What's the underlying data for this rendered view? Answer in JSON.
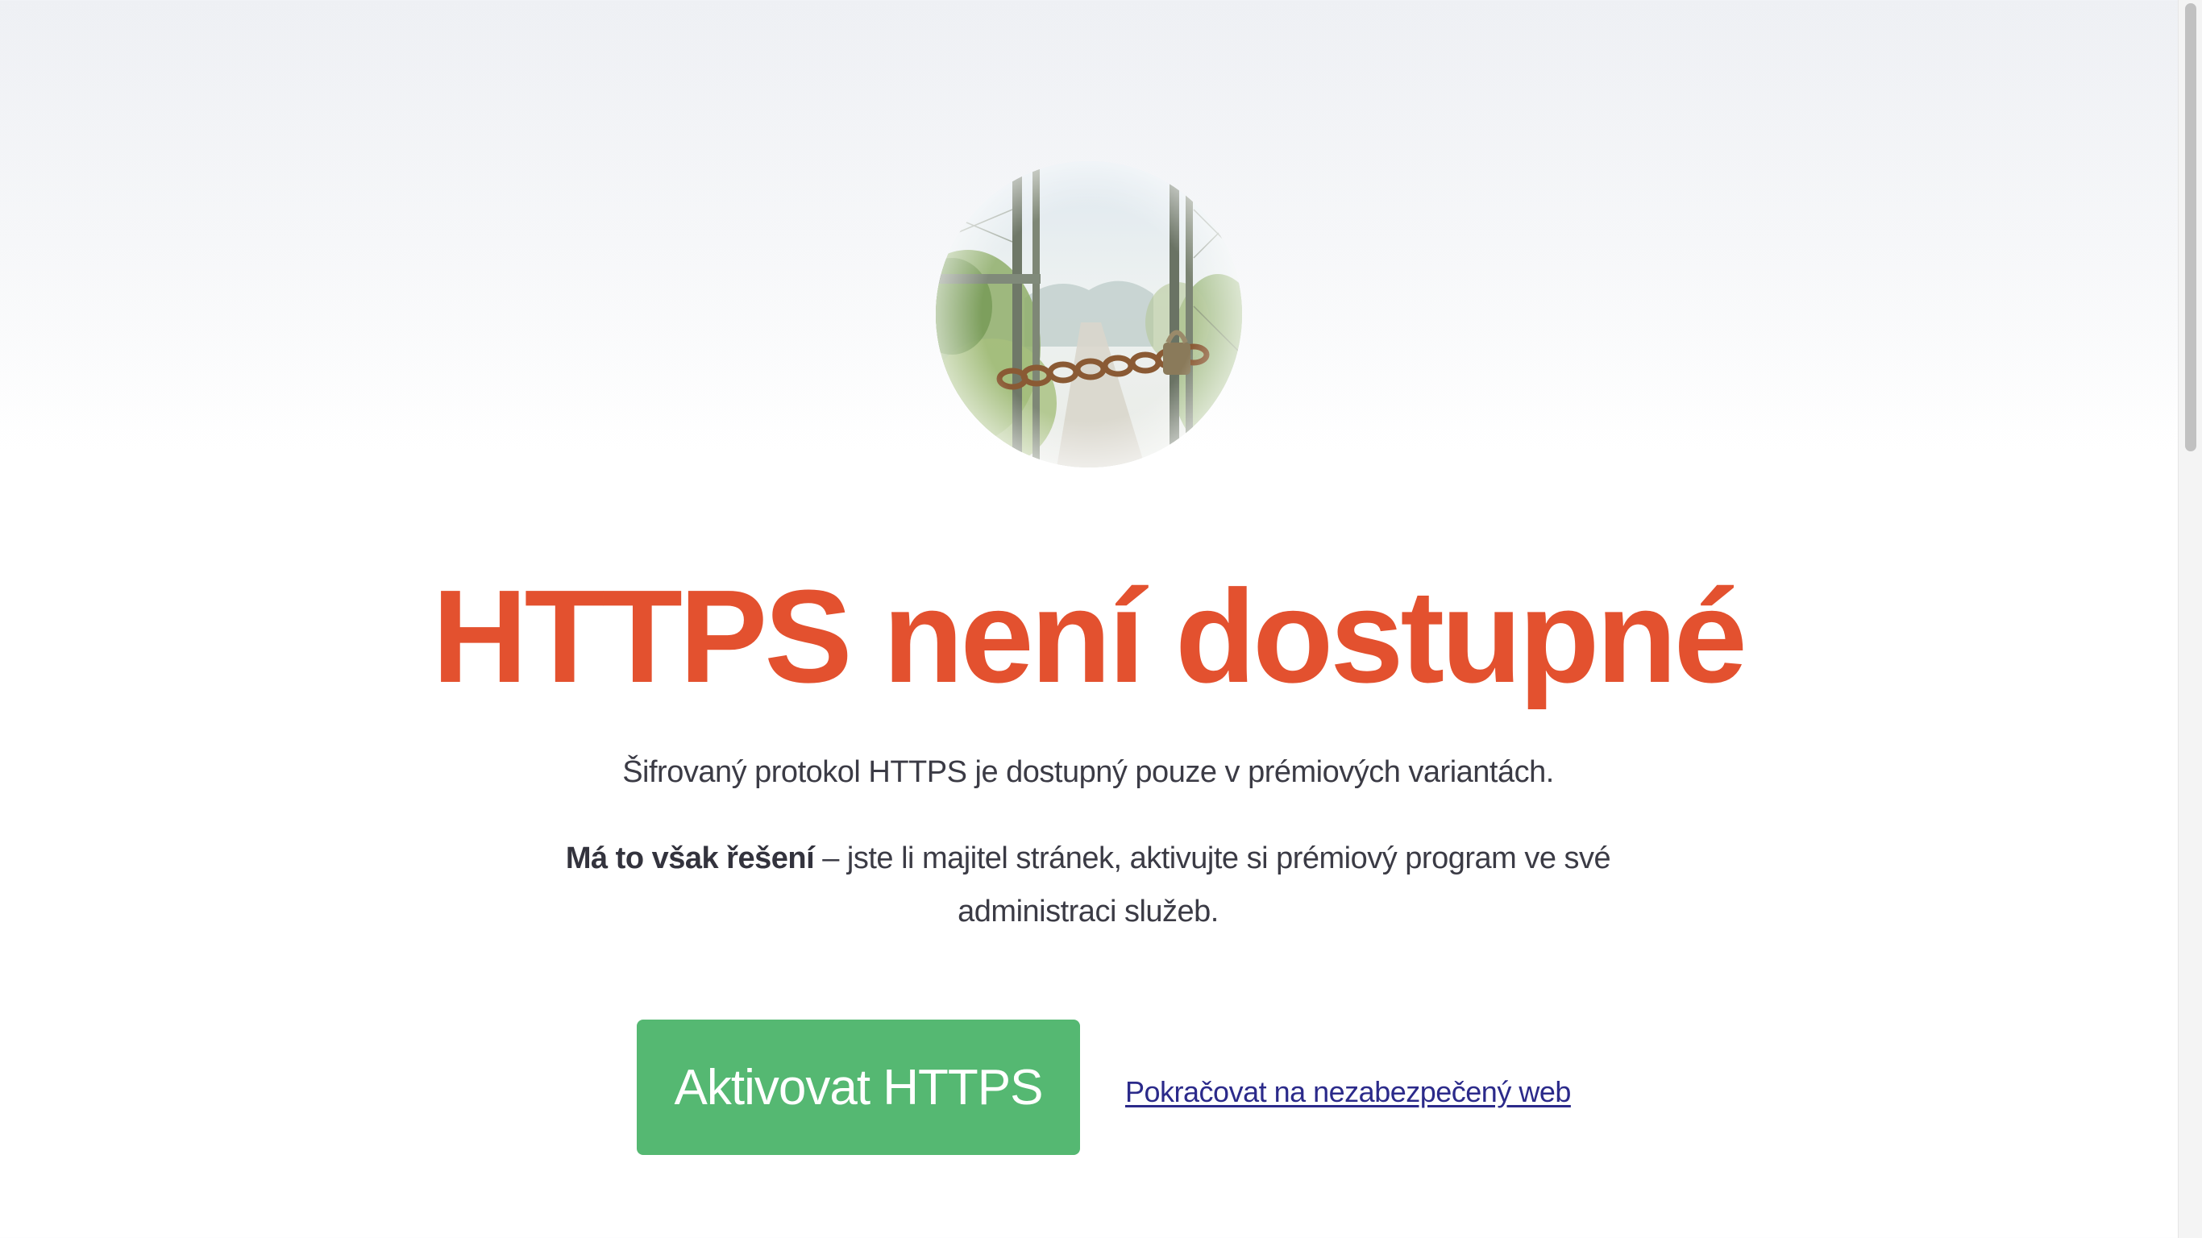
{
  "hero": {
    "image_name": "locked-gate-chain-photo"
  },
  "title": "HTTPS není dostupné",
  "lead": "Šifrovaný protokol HTTPS je dostupný pouze v prémiových variantách.",
  "solution": {
    "bold": "Má to však řešení",
    "rest": " – jste li majitel stránek, aktivujte si prémiový program ve své administraci služeb."
  },
  "actions": {
    "activate_label": "Aktivovat HTTPS",
    "continue_label": "Pokračovat na nezabezpečený web"
  },
  "colors": {
    "title": "#e3512f",
    "button": "#55b872",
    "link": "#2b2a8a"
  }
}
